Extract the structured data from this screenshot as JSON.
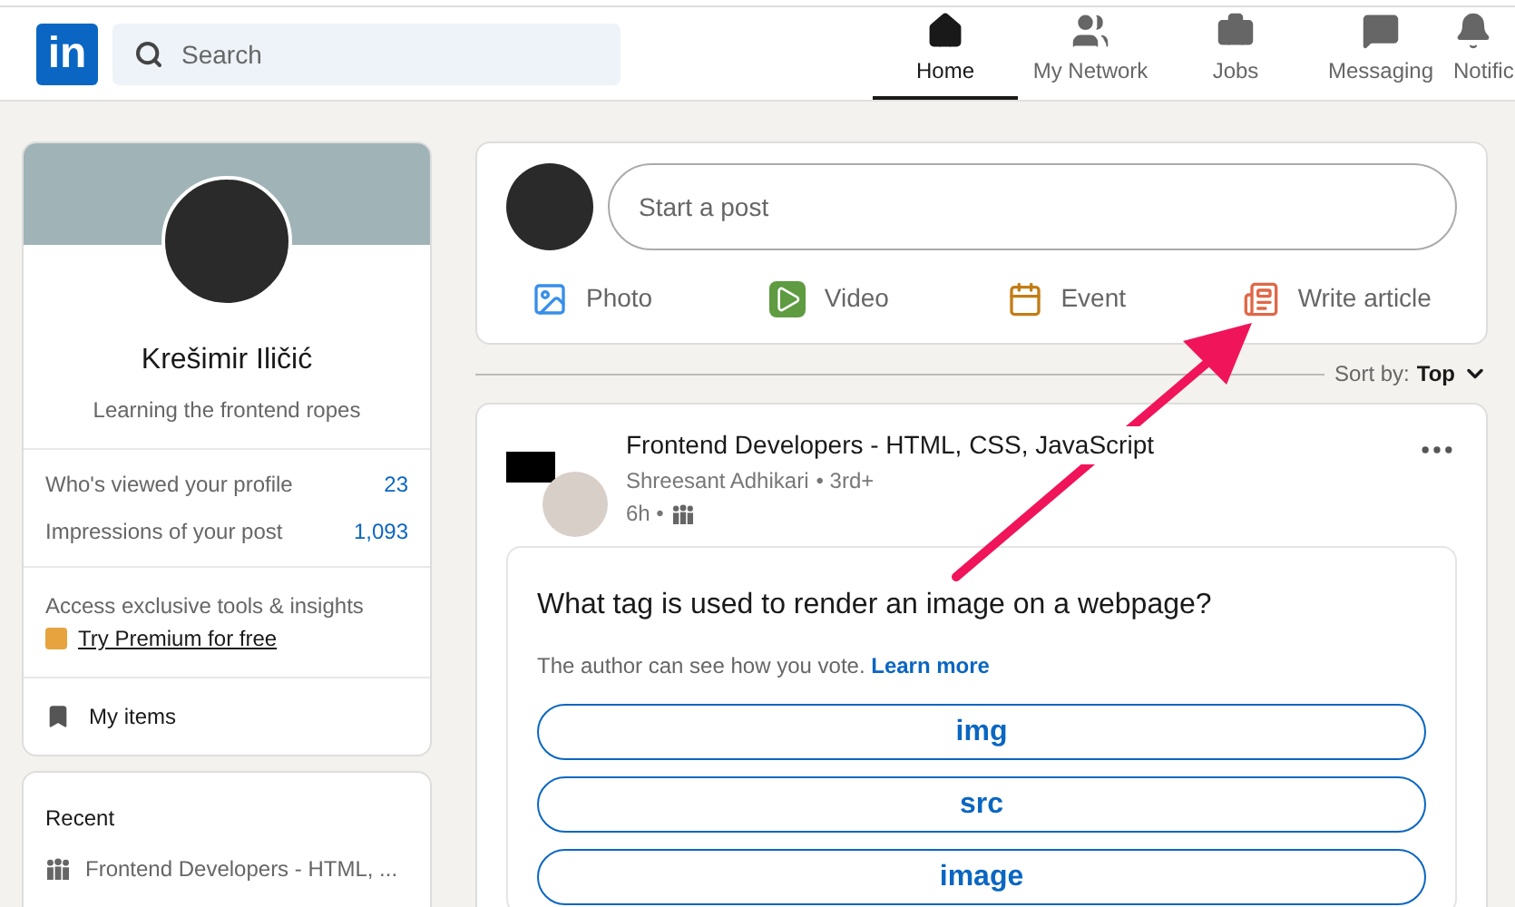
{
  "header": {
    "logo": "in",
    "search": {
      "placeholder": "Search"
    },
    "nav": [
      {
        "kind": "home",
        "label": "Home",
        "selected": true
      },
      {
        "kind": "network",
        "label": "My Network",
        "selected": false
      },
      {
        "kind": "jobs",
        "label": "Jobs",
        "selected": false
      },
      {
        "kind": "messaging",
        "label": "Messaging",
        "selected": false
      },
      {
        "kind": "notifications",
        "label": "Notific",
        "selected": false
      }
    ]
  },
  "profile": {
    "name": "Krešimir Iličić",
    "headline": "Learning the frontend ropes",
    "stats": [
      {
        "label": "Who's viewed your profile",
        "value": "23"
      },
      {
        "label": "Impressions of your post",
        "value": "1,093"
      }
    ],
    "premium": {
      "text": "Access exclusive tools & insights",
      "link": "Try Premium for free"
    },
    "my_items": "My items"
  },
  "recent": {
    "title": "Recent",
    "items": [
      "Frontend Developers - HTML, ..."
    ]
  },
  "composer": {
    "placeholder": "Start a post",
    "actions": [
      {
        "kind": "photo",
        "label": "Photo"
      },
      {
        "kind": "video",
        "label": "Video"
      },
      {
        "kind": "event",
        "label": "Event"
      },
      {
        "kind": "article",
        "label": "Write article"
      }
    ]
  },
  "sort": {
    "label": "Sort by:",
    "value": "Top"
  },
  "post": {
    "group": "Frontend Developers - HTML, CSS, JavaScript",
    "author": "Shreesant Adhikari",
    "degree": "• 3rd+",
    "time": "6h •",
    "poll": {
      "question": "What tag is used to render an image on a webpage?",
      "note": "The author can see how you vote.",
      "link": "Learn more",
      "options": [
        "img",
        "src",
        "image"
      ]
    }
  }
}
